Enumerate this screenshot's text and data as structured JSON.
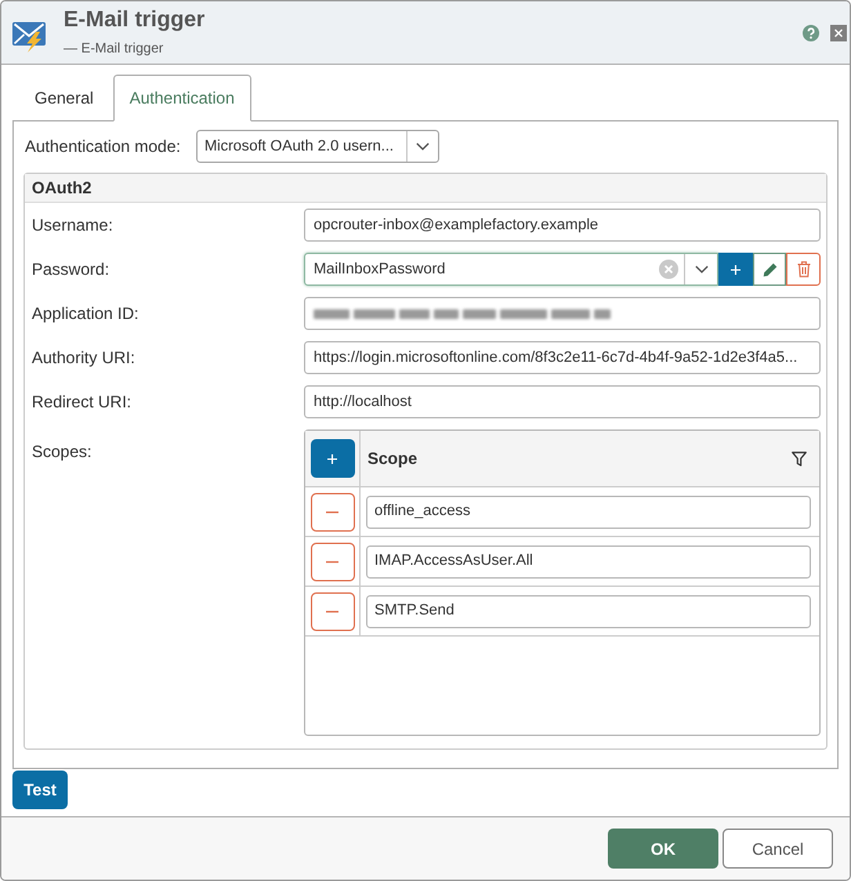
{
  "window": {
    "title": "E-Mail trigger",
    "subtitle": "— E-Mail trigger"
  },
  "tabs": [
    {
      "label": "General",
      "selected": false
    },
    {
      "label": "Authentication",
      "selected": true
    }
  ],
  "authentication_mode": {
    "label": "Authentication mode:",
    "value": "Microsoft OAuth 2.0 usern..."
  },
  "oauth2": {
    "title": "OAuth2",
    "fields": [
      {
        "label": "Username:",
        "kind": "text",
        "value": "opcrouter-inbox@examplefactory.example",
        "focused": false
      },
      {
        "label": "Password:",
        "kind": "credential",
        "value": "MailInboxPassword",
        "focused": true
      },
      {
        "label": "Application ID:",
        "kind": "blurred",
        "focused": false
      },
      {
        "label": "Authority URI:",
        "kind": "text",
        "value": "https://login.microsoftonline.com/8f3c2e11-6c7d-4b4f-9a52-1d2e3f4a5...",
        "focused": false
      },
      {
        "label": "Redirect URI:",
        "kind": "text",
        "value": "http://localhost",
        "focused": false
      }
    ],
    "scopes": {
      "label": "Scopes:",
      "column": "Scope",
      "rows": [
        {
          "value": "offline_access"
        },
        {
          "value": "IMAP.AccessAsUser.All"
        },
        {
          "value": "SMTP.Send"
        }
      ]
    }
  },
  "buttons": {
    "test": "Test",
    "ok": "OK",
    "cancel": "Cancel"
  }
}
